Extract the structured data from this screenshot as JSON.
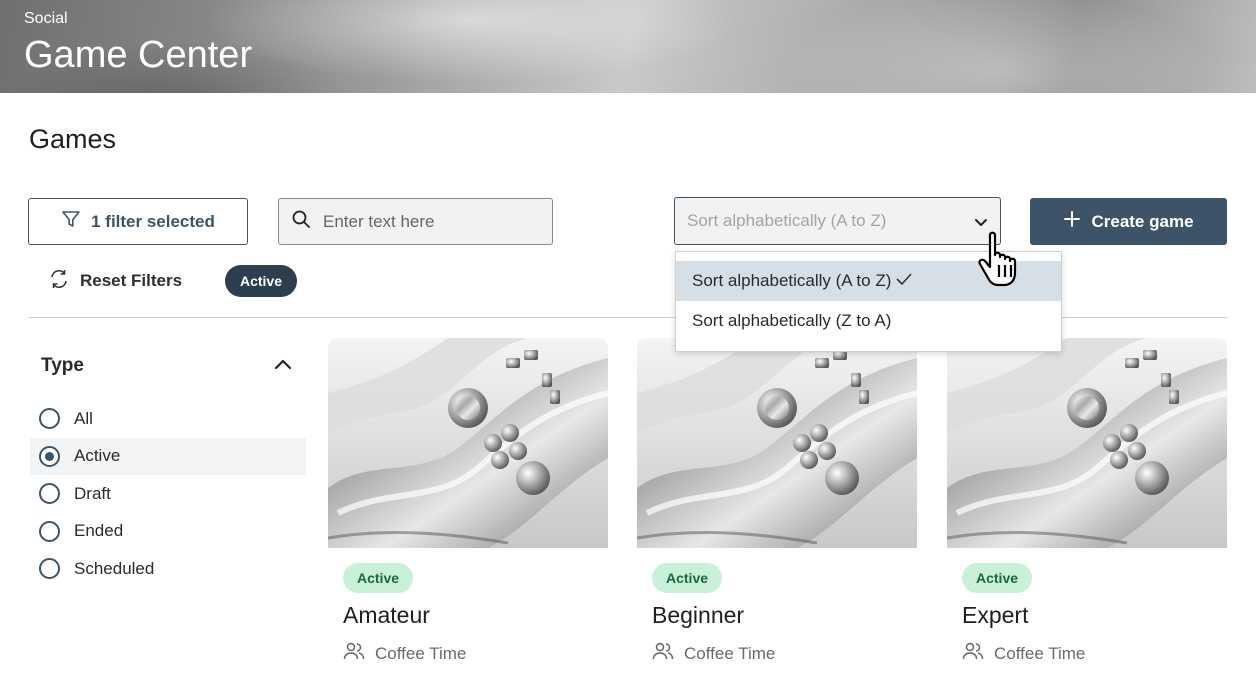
{
  "banner": {
    "subtitle": "Social",
    "title": "Game Center"
  },
  "page": {
    "title": "Games"
  },
  "toolbar": {
    "filter_label": "1 filter selected",
    "search_placeholder": "Enter text here",
    "sort_value": "Sort alphabetically (A to Z)",
    "create_label": "Create game"
  },
  "sort_dropdown": {
    "options": [
      {
        "label": "Sort alphabetically (A to Z)",
        "selected": true
      },
      {
        "label": "Sort alphabetically (Z to A)",
        "selected": false
      }
    ],
    "check": "✓"
  },
  "filters": {
    "reset_label": "Reset Filters",
    "active_chip": "Active"
  },
  "sidebar": {
    "type_title": "Type",
    "options": [
      {
        "label": "All",
        "checked": false
      },
      {
        "label": "Active",
        "checked": true
      },
      {
        "label": "Draft",
        "checked": false
      },
      {
        "label": "Ended",
        "checked": false
      },
      {
        "label": "Scheduled",
        "checked": false
      }
    ]
  },
  "cards": [
    {
      "status": "Active",
      "title": "Amateur",
      "meta": "Coffee Time"
    },
    {
      "status": "Active",
      "title": "Beginner",
      "meta": "Coffee Time"
    },
    {
      "status": "Active",
      "title": "Expert",
      "meta": "Coffee Time"
    }
  ],
  "colors": {
    "primary": "#3d5468",
    "chip": "#2d3e4e",
    "badge_bg": "#c9f0d8",
    "badge_text": "#186a3b",
    "selected_row": "#d7dfe6"
  },
  "icons": [
    "filter-icon",
    "search-icon",
    "chevron-down-icon",
    "plus-icon",
    "refresh-icon",
    "chevron-up-icon",
    "users-icon",
    "pointer-hand-icon",
    "checkmark-icon"
  ]
}
